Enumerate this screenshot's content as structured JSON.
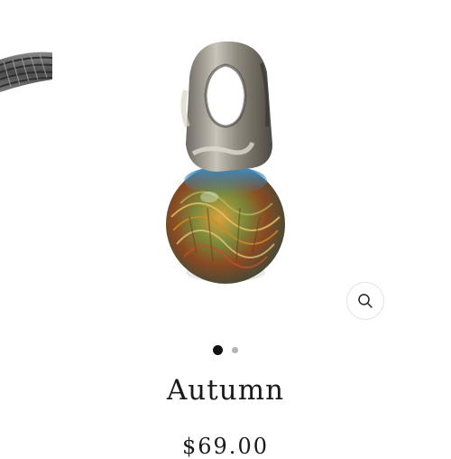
{
  "product": {
    "title": "Autumn",
    "price": "$69.00"
  },
  "gallery": {
    "slide_count": 2,
    "active_slide": 1,
    "main_image_icon": "bead-charm-image",
    "prev_image_icon": "bracelet-chain-image",
    "zoom_icon": "magnifier-icon"
  }
}
